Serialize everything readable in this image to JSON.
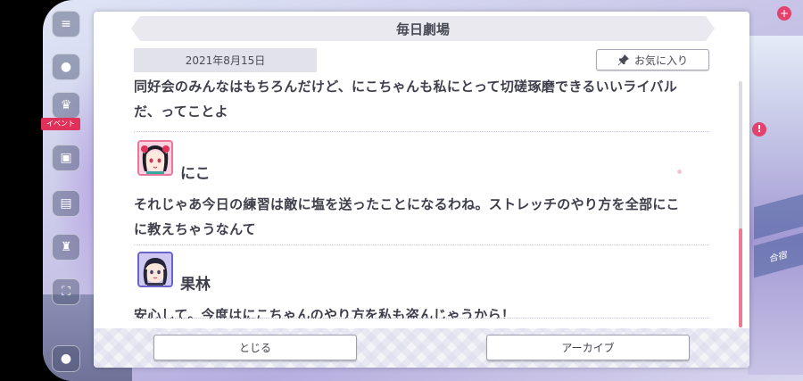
{
  "dialog": {
    "title": "毎日劇場",
    "date": "2021年8月15日",
    "favorite_label": "お気に入り",
    "close_label": "とじる",
    "archive_label": "アーカイブ"
  },
  "lines": [
    {
      "text1": "同好会のみんなはもちろんだけど、にこちゃんも私にとって切磋琢磨できるいいライバル",
      "text2": "だ、ってことよ"
    },
    {
      "speaker": "にこ",
      "text1": "それじゃあ今日の練習は敵に塩を送ったことになるわね。ストレッチのやり方を全部にこ",
      "text2": "に教えちゃうなんて"
    },
    {
      "speaker": "果林",
      "text1": "安心して。今度はにこちゃんのやり方を私も盗んじゃうから！"
    }
  ],
  "background": {
    "side_tag": "イベント",
    "right_tile": "合宿"
  },
  "colors": {
    "accent": "#ea7c93",
    "nico_avatar_border": "#e87799",
    "karin_avatar_border": "#6a63c9"
  }
}
